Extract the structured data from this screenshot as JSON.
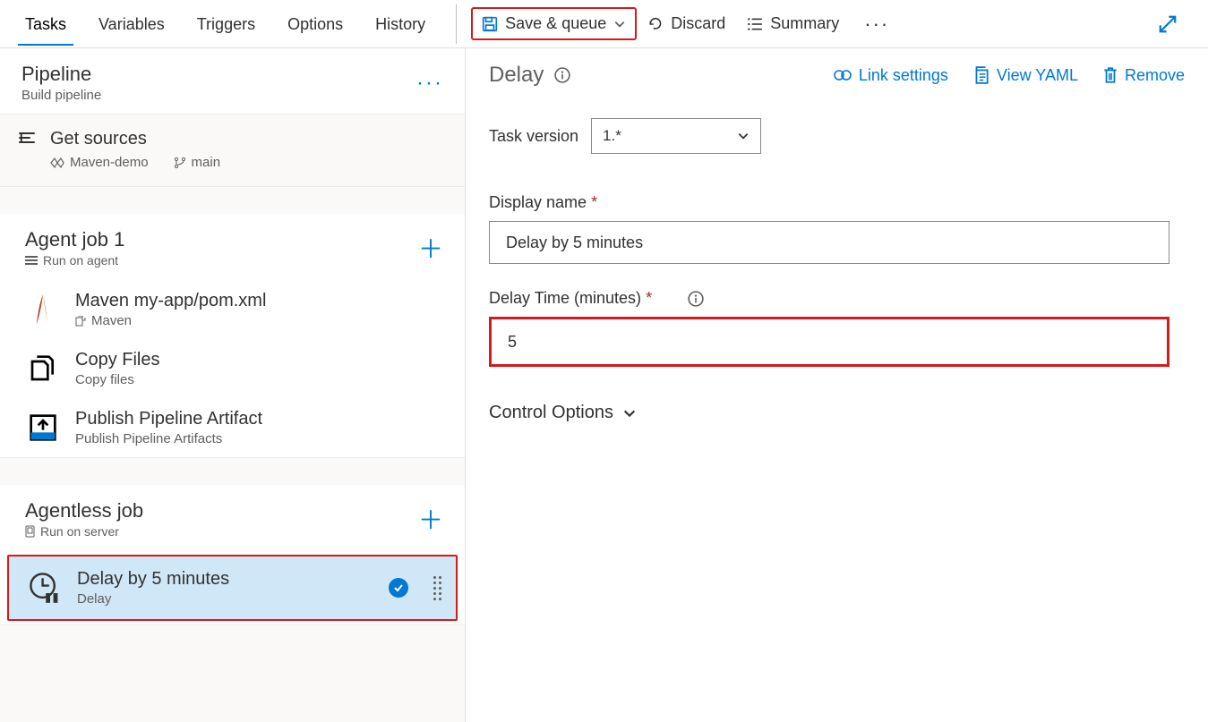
{
  "tabs": [
    "Tasks",
    "Variables",
    "Triggers",
    "Options",
    "History"
  ],
  "active_tab": "Tasks",
  "toolbar": {
    "save_queue": "Save & queue",
    "discard": "Discard",
    "summary": "Summary"
  },
  "pipeline": {
    "title": "Pipeline",
    "subtitle": "Build pipeline"
  },
  "sources": {
    "title": "Get sources",
    "repo": "Maven-demo",
    "branch": "main"
  },
  "jobs": [
    {
      "title": "Agent job 1",
      "subtitle": "Run on agent",
      "tasks": [
        {
          "title": "Maven my-app/pom.xml",
          "subtitle": "Maven",
          "icon": "maven"
        },
        {
          "title": "Copy Files",
          "subtitle": "Copy files",
          "icon": "copy"
        },
        {
          "title": "Publish Pipeline Artifact",
          "subtitle": "Publish Pipeline Artifacts",
          "icon": "publish"
        }
      ]
    },
    {
      "title": "Agentless job",
      "subtitle": "Run on server",
      "tasks": [
        {
          "title": "Delay by 5 minutes",
          "subtitle": "Delay",
          "icon": "delay",
          "selected": true
        }
      ]
    }
  ],
  "panel": {
    "heading": "Delay",
    "links": {
      "link_settings": "Link settings",
      "view_yaml": "View YAML",
      "remove": "Remove"
    },
    "task_version_label": "Task version",
    "task_version_value": "1.*",
    "display_name_label": "Display name",
    "display_name_value": "Delay by 5 minutes",
    "delay_time_label": "Delay Time (minutes)",
    "delay_time_value": "5",
    "control_options": "Control Options"
  }
}
